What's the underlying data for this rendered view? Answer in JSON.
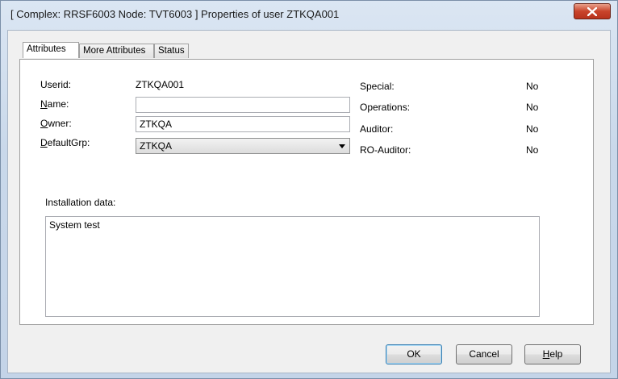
{
  "window": {
    "title": "[ Complex: RRSF6003 Node: TVT6003 ] Properties of user ZTKQA001"
  },
  "tabs": [
    {
      "label": "Attributes",
      "active": true
    },
    {
      "label": "More Attributes",
      "active": false
    },
    {
      "label": "Status",
      "active": false
    }
  ],
  "attributes": {
    "userid_label": "Userid:",
    "userid_value": "ZTKQA001",
    "name_label_first": "N",
    "name_label_rest": "ame:",
    "name_value": "",
    "owner_label_first": "O",
    "owner_label_rest": "wner:",
    "owner_value": "ZTKQA",
    "defaultgrp_label_first": "D",
    "defaultgrp_label_rest": "efaultGrp:",
    "defaultgrp_value": "ZTKQA",
    "flags": [
      {
        "label": "Special:",
        "value": "No"
      },
      {
        "label": "Operations:",
        "value": "No"
      },
      {
        "label": "Auditor:",
        "value": "No"
      },
      {
        "label": "RO-Auditor:",
        "value": "No"
      }
    ],
    "installation_label": "Installation data:",
    "installation_value": "System test"
  },
  "buttons": {
    "ok": "OK",
    "cancel": "Cancel",
    "help_first": "H",
    "help_rest": "elp"
  },
  "colors": {
    "close_button": "#c9442b",
    "default_button_border": "#3c7fb1"
  }
}
